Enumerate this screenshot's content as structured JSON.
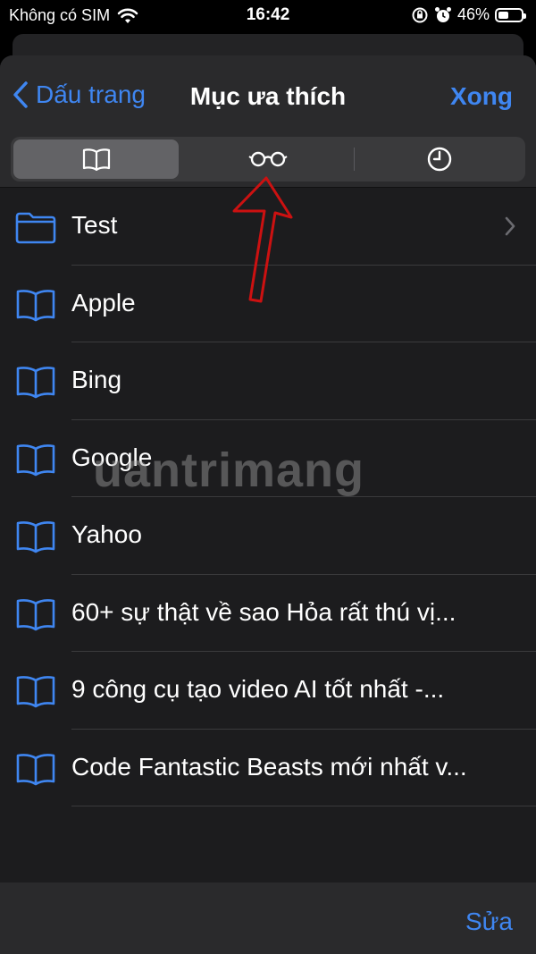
{
  "status": {
    "carrier": "Không có SIM",
    "time": "16:42",
    "battery": "46%",
    "battery_level": 0.46
  },
  "nav": {
    "back_label": "Dấu trang",
    "title": "Mục ưa thích",
    "done_label": "Xong"
  },
  "segments": [
    {
      "icon": "book-icon",
      "active": true
    },
    {
      "icon": "glasses-icon",
      "active": false
    },
    {
      "icon": "clock-icon",
      "active": false
    }
  ],
  "bookmarks": [
    {
      "label": "Test",
      "icon": "folder-icon"
    },
    {
      "label": "Apple",
      "icon": "book-icon"
    },
    {
      "label": "Bing",
      "icon": "book-icon"
    },
    {
      "label": "Google",
      "icon": "book-icon"
    },
    {
      "label": "Yahoo",
      "icon": "book-icon"
    },
    {
      "label": "60+ sự thật về sao Hỏa rất thú vị...",
      "icon": "book-icon"
    },
    {
      "label": "9 công cụ tạo video AI tốt nhất -...",
      "icon": "book-icon"
    },
    {
      "label": "Code Fantastic Beasts mới nhất v...",
      "icon": "book-icon"
    }
  ],
  "toolbar": {
    "edit_label": "Sửa"
  },
  "watermark": "uantrimang",
  "colors": {
    "accent": "#3f86f1",
    "annotation": "#cc1111"
  }
}
